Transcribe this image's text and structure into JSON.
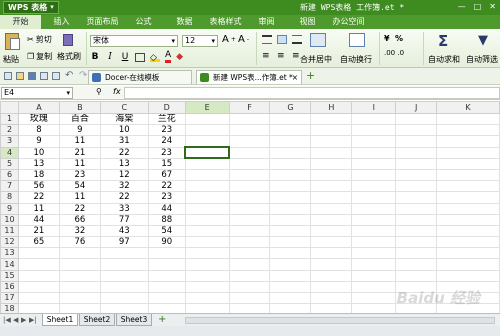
{
  "app": {
    "logo": "WPS 表格",
    "window_title": "新建 WPS表格 工作簿.et *"
  },
  "menu": [
    "开始",
    "插入",
    "页面布局",
    "公式",
    "数据",
    "表格样式",
    "审阅",
    "视图",
    "办公空间"
  ],
  "ribbon": {
    "paste": "粘贴",
    "cut": "剪切",
    "copy": "复制",
    "format_painter": "格式刷",
    "font": "宋体",
    "font_size": "12",
    "merge_center": "合并居中",
    "wrap_text": "自动换行",
    "percent": "%",
    "autosum": "自动求和",
    "autofilter": "自动筛选"
  },
  "doc_tabs": [
    {
      "label": "Docer-在线模板"
    },
    {
      "label": "新建 WPS表...作簿.et *"
    }
  ],
  "formula_bar": {
    "cell_ref": "E4",
    "fx": "fx"
  },
  "grid": {
    "columns": [
      "A",
      "B",
      "C",
      "D",
      "E",
      "F",
      "G",
      "H",
      "I",
      "J",
      "K"
    ],
    "headers": [
      "玫瑰",
      "百合",
      "海棠",
      "兰花"
    ],
    "rows": [
      [
        "8",
        "9",
        "10",
        "23"
      ],
      [
        "9",
        "11",
        "31",
        "24"
      ],
      [
        "10",
        "21",
        "22",
        "23"
      ],
      [
        "13",
        "11",
        "13",
        "15"
      ],
      [
        "18",
        "23",
        "12",
        "67"
      ],
      [
        "56",
        "54",
        "32",
        "22"
      ],
      [
        "22",
        "11",
        "22",
        "23"
      ],
      [
        "11",
        "22",
        "33",
        "44"
      ],
      [
        "44",
        "66",
        "77",
        "88"
      ],
      [
        "21",
        "32",
        "43",
        "54"
      ],
      [
        "65",
        "76",
        "97",
        "90"
      ]
    ],
    "row_numbers": [
      "1",
      "2",
      "3",
      "4",
      "5",
      "6",
      "7",
      "8",
      "9",
      "10",
      "11",
      "12",
      "13",
      "14",
      "15",
      "16",
      "17",
      "18"
    ]
  },
  "sheets": [
    "Sheet1",
    "Sheet2",
    "Sheet3"
  ],
  "watermark": "Baidu 经验"
}
